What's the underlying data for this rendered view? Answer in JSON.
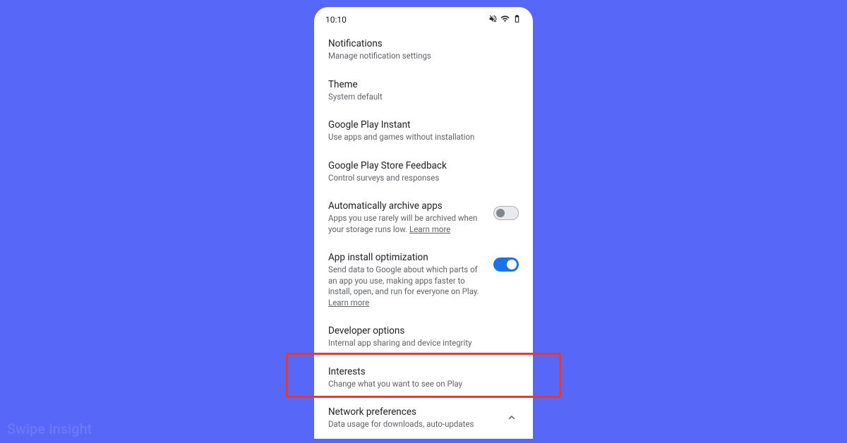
{
  "statusBar": {
    "time": "10:10"
  },
  "settings": {
    "notifications": {
      "title": "Notifications",
      "sub": "Manage notification settings"
    },
    "theme": {
      "title": "Theme",
      "sub": "System default"
    },
    "playInstant": {
      "title": "Google Play Instant",
      "sub": "Use apps and games without installation"
    },
    "feedback": {
      "title": "Google Play Store Feedback",
      "sub": "Control surveys and responses"
    },
    "archive": {
      "title": "Automatically archive apps",
      "sub1": "Apps you use rarely will be archived when your storage runs low. ",
      "learnMore": "Learn more"
    },
    "optimization": {
      "title": "App install optimization",
      "sub1": "Send data to Google about which parts of an app you use, making apps faster to install, open, and run for everyone on Play. ",
      "learnMore": "Learn more"
    },
    "developer": {
      "title": "Developer options",
      "sub": "Internal app sharing and device integrity"
    },
    "interests": {
      "title": "Interests",
      "sub": "Change what you want to see on Play"
    },
    "network": {
      "title": "Network preferences",
      "sub": "Data usage for downloads, auto-updates"
    }
  },
  "watermark": "Swipe Insight"
}
